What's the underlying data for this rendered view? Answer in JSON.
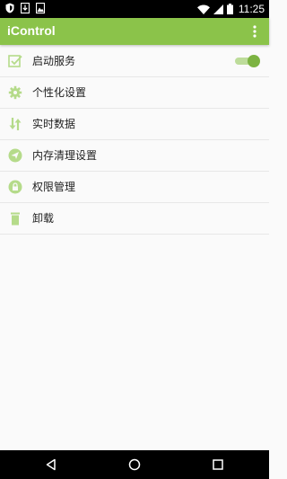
{
  "status_bar": {
    "time": "11:25",
    "left_icons": [
      "shield-icon",
      "download-icon",
      "image-icon"
    ],
    "right_icons": [
      "wifi-icon",
      "signal-icon",
      "battery-icon"
    ]
  },
  "app_bar": {
    "title": "iControl",
    "menu_icon": "more-vert-icon"
  },
  "menu": {
    "items": [
      {
        "label": "启动服务",
        "icon": "checkbox-icon",
        "toggle_on": true
      },
      {
        "label": "个性化设置",
        "icon": "gear-icon"
      },
      {
        "label": "实时数据",
        "icon": "transfer-arrows-icon"
      },
      {
        "label": "内存清理设置",
        "icon": "send-icon"
      },
      {
        "label": "权限管理",
        "icon": "lock-icon"
      },
      {
        "label": "卸载",
        "icon": "trash-icon"
      }
    ]
  },
  "nav_bar": {
    "buttons": [
      "back-icon",
      "home-icon",
      "recents-icon"
    ]
  },
  "colors": {
    "accent": "#8bc34a",
    "icon": "#b5db8a",
    "toggle_thumb": "#7cb342",
    "toggle_track": "#bddc9a",
    "status_bar": "#000000",
    "nav_bar": "#000000",
    "background": "#fafafa"
  }
}
